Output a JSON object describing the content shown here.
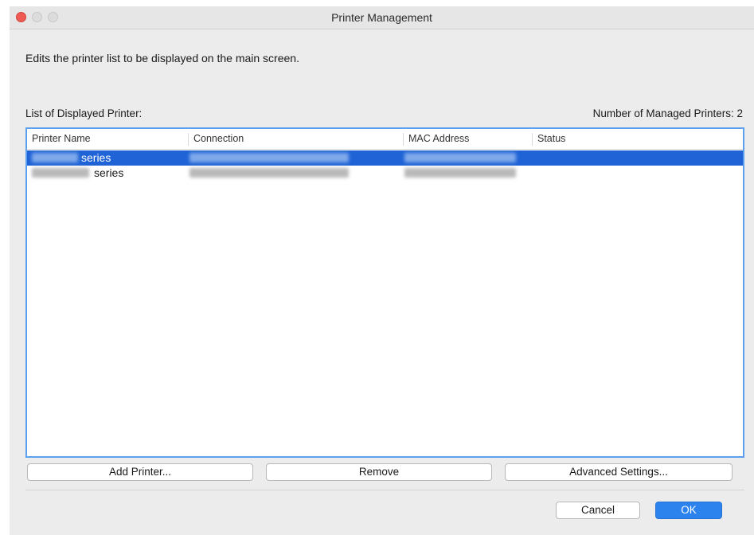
{
  "window": {
    "title": "Printer Management"
  },
  "description": "Edits the printer list to be displayed on the main screen.",
  "list": {
    "label": "List of Displayed Printer:",
    "managed_count_text": "Number of Managed Printers: 2",
    "columns": [
      "Printer Name",
      "Connection",
      "MAC Address",
      "Status"
    ],
    "rows": [
      {
        "printer_name": "series",
        "selected": true
      },
      {
        "printer_name": "series",
        "selected": false
      }
    ]
  },
  "buttons": {
    "add_printer": "Add Printer...",
    "remove": "Remove",
    "advanced_settings": "Advanced Settings...",
    "cancel": "Cancel",
    "ok": "OK"
  },
  "colors": {
    "selection": "#1f63d6",
    "focus_border": "#5aa0ee",
    "close_button": "#ee5b52",
    "default_button": "#2d83ee"
  }
}
